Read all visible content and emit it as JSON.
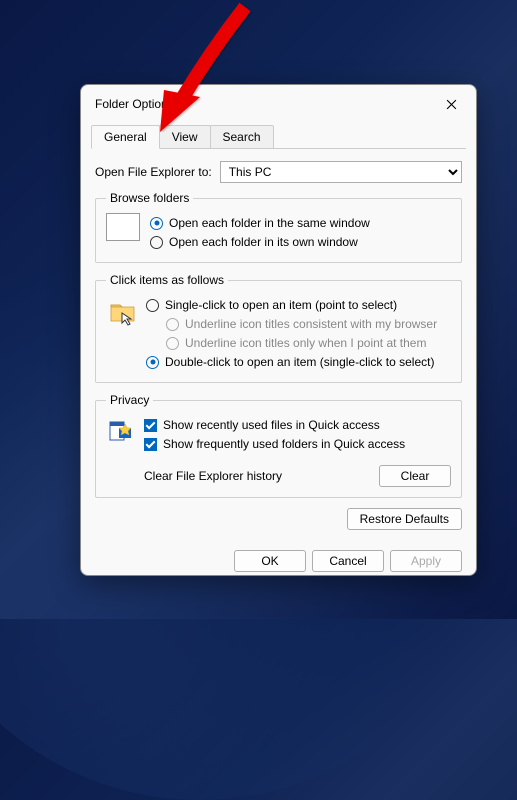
{
  "window": {
    "title": "Folder Options",
    "tabs": [
      "General",
      "View",
      "Search"
    ],
    "active_tab": 0
  },
  "open_explorer": {
    "label": "Open File Explorer to:",
    "value": "This PC"
  },
  "browse_folders": {
    "legend": "Browse folders",
    "opt_same": "Open each folder in the same window",
    "opt_own": "Open each folder in its own window",
    "selected": "same"
  },
  "click_items": {
    "legend": "Click items as follows",
    "single": "Single-click to open an item (point to select)",
    "underline_browser": "Underline icon titles consistent with my browser",
    "underline_point": "Underline icon titles only when I point at them",
    "double": "Double-click to open an item (single-click to select)",
    "selected": "double"
  },
  "privacy": {
    "legend": "Privacy",
    "recent_files": "Show recently used files in Quick access",
    "recent_folders": "Show frequently used folders in Quick access",
    "recent_files_checked": true,
    "recent_folders_checked": true,
    "clear_label": "Clear File Explorer history",
    "clear_btn": "Clear"
  },
  "buttons": {
    "restore": "Restore Defaults",
    "ok": "OK",
    "cancel": "Cancel",
    "apply": "Apply"
  },
  "annotation": {
    "arrow_points_to": "View tab"
  }
}
